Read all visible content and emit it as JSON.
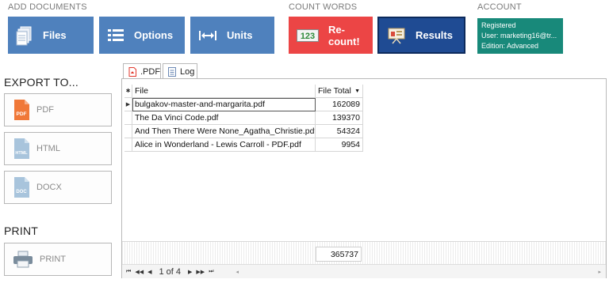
{
  "sections": {
    "add_documents": "ADD DOCUMENTS",
    "count_words": "COUNT WORDS",
    "account": "ACCOUNT"
  },
  "toolbar": {
    "files": "Files",
    "options": "Options",
    "units": "Units",
    "recount": "Re-count!",
    "results": "Results"
  },
  "account_info": {
    "status": "Registered",
    "user": "User: marketing16@tr...",
    "edition": "Edition: Advanced"
  },
  "export": {
    "title": "EXPORT TO...",
    "pdf": "PDF",
    "html": "HTML",
    "docx": "DOCX"
  },
  "print": {
    "title": "PRINT",
    "button": "PRINT"
  },
  "tabs": {
    "pdf": ".PDF",
    "log": "Log"
  },
  "table": {
    "col_file": "File",
    "col_total": "File Total",
    "rows": [
      {
        "file": "bulgakov-master-and-margarita.pdf",
        "total": "162089"
      },
      {
        "file": "The Da Vinci Code.pdf",
        "total": "139370"
      },
      {
        "file": "And Then There Were None_Agatha_Christie.pdf",
        "total": "54324"
      },
      {
        "file": "Alice in Wonderland - Lewis Carroll - PDF.pdf",
        "total": "9954"
      }
    ],
    "grand_total": "365737"
  },
  "pager": {
    "text": "1 of 4"
  },
  "colors": {
    "blue": "#4f81bd",
    "red": "#ec4545",
    "navy": "#1f4b93",
    "teal": "#18897a"
  }
}
